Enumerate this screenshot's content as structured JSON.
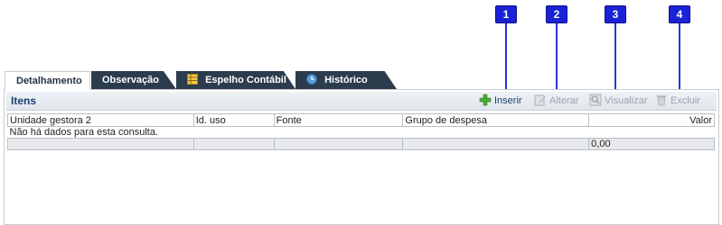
{
  "markers": [
    "1",
    "2",
    "3",
    "4"
  ],
  "tabs": [
    {
      "label": "Detalhamento",
      "icon": "none"
    },
    {
      "label": "Observação",
      "icon": "none"
    },
    {
      "label": "Espelho Contábil",
      "icon": "ledger-icon"
    },
    {
      "label": "Histórico",
      "icon": "history-icon"
    }
  ],
  "panel": {
    "title": "Itens",
    "toolbar": {
      "insert": "Inserir",
      "edit": "Alterar",
      "view": "Visualizar",
      "delete": "Excluir"
    }
  },
  "table": {
    "columns": [
      "Unidade gestora 2",
      "Id. uso",
      "Fonte",
      "Grupo de despesa",
      "Valor"
    ],
    "empty_message": "Não há dados para esta consulta.",
    "total_value": "0,00"
  },
  "colors": {
    "marker": "#1a22d6",
    "active_tab_text": "#23323f",
    "dark_tab": "#2b3c4d",
    "panel_title": "#1d3f6e"
  }
}
